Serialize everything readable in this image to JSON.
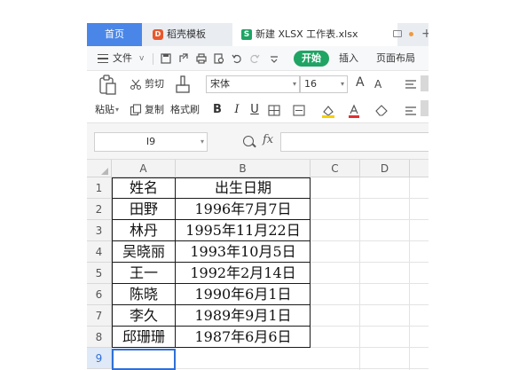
{
  "tabs": [
    {
      "label": "首页",
      "active": true
    },
    {
      "label": "稻壳模板",
      "icon": "docer-logo-icon"
    },
    {
      "label": "新建 XLSX 工作表.xlsx",
      "icon": "spreadsheet-icon"
    }
  ],
  "menu": {
    "file_label": "文件",
    "start_label": "开始",
    "insert_label": "插入",
    "layout_label": "页面布局"
  },
  "ribbon": {
    "paste_label": "粘贴",
    "cut_label": "剪切",
    "copy_label": "复制",
    "format_painter_label": "格式刷",
    "font_name": "宋体",
    "font_size": "16",
    "bold": "B",
    "italic": "I",
    "underline": "U",
    "font_grow": "A",
    "font_shrink": "A"
  },
  "formula_bar": {
    "cell_reference": "I9",
    "fx_label": "fx",
    "formula": ""
  },
  "sheet": {
    "columns": [
      "A",
      "B",
      "C",
      "D"
    ],
    "rows": [
      "1",
      "2",
      "3",
      "4",
      "5",
      "6",
      "7",
      "8",
      "9"
    ],
    "active_row": "9",
    "data": [
      [
        "姓名",
        "出生日期"
      ],
      [
        "田野",
        "1996年7月7日"
      ],
      [
        "林丹",
        "1995年11月22日"
      ],
      [
        "吴晓丽",
        "1993年10月5日"
      ],
      [
        "王一",
        "1992年2月14日"
      ],
      [
        "陈晓",
        "1990年6月1日"
      ],
      [
        "李久",
        "1989年9月1日"
      ],
      [
        "邱珊珊",
        "1987年6月6日"
      ]
    ]
  },
  "colors": {
    "accent": "#4a86e8",
    "start_green": "#1fa463",
    "selection": "#2f6fd6"
  }
}
